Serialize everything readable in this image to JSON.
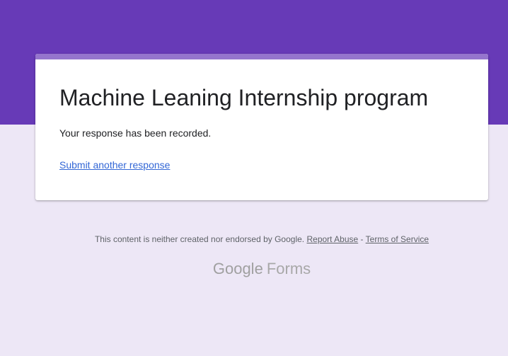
{
  "header": {
    "accent_color": "#673ab7",
    "background_color": "#ede7f6"
  },
  "card": {
    "title": "Machine Leaning Internship program",
    "confirmation_message": "Your response has been recorded.",
    "submit_another_label": "Submit another response"
  },
  "footer": {
    "disclaimer": "This content is neither created nor endorsed by Google.",
    "report_abuse_label": "Report Abuse",
    "separator": "-",
    "terms_label": "Terms of Service",
    "brand_google": "Google",
    "brand_forms": "Forms"
  }
}
